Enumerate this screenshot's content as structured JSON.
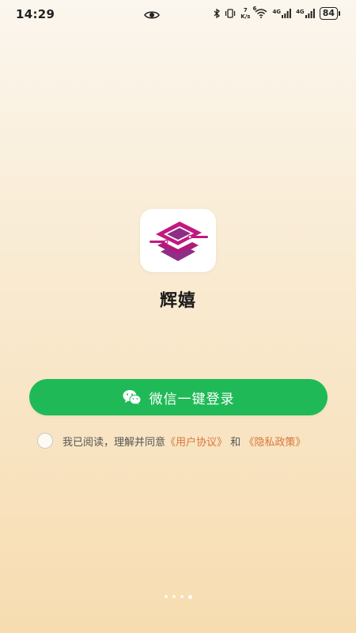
{
  "status_bar": {
    "time": "14:29",
    "net_speed_value": "7",
    "net_speed_unit": "K/s",
    "wifi_badge": "6",
    "signal1_label": "4G",
    "signal2_label": "4G",
    "battery": "84",
    "icons": [
      "eye-icon",
      "bluetooth-icon",
      "vibrate-icon",
      "wifi-icon",
      "signal-icon",
      "battery-icon"
    ]
  },
  "app": {
    "name": "辉嬉",
    "logo_colors": [
      "#c2187f",
      "#8e2e86"
    ]
  },
  "login": {
    "wechat_button_label": "微信一键登录",
    "button_color": "#1fba57"
  },
  "agreement": {
    "prefix": "我已阅读，理解并同意",
    "user_agreement": "《用户协议》",
    "joiner": "和",
    "privacy_policy": "《隐私政策》",
    "link_color": "#d9773a"
  },
  "pager": {
    "total": 4,
    "active_index": 3
  }
}
